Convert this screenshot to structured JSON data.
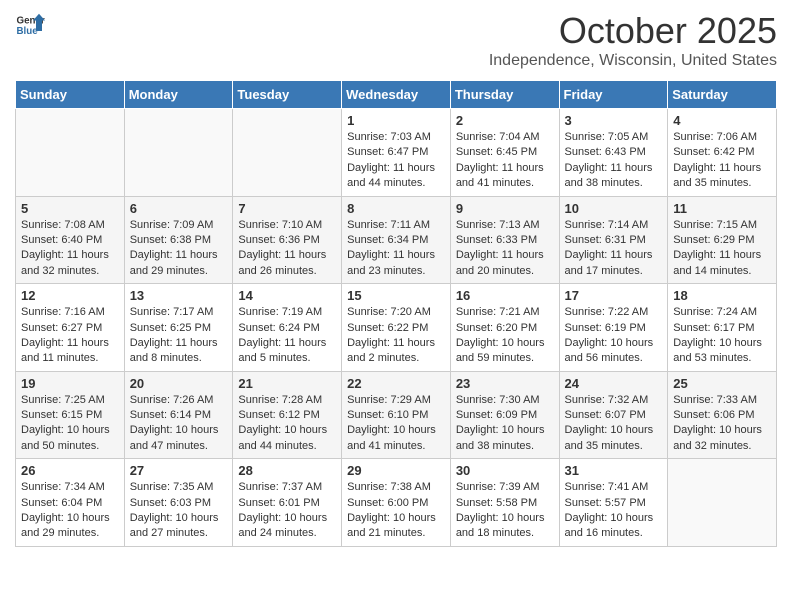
{
  "header": {
    "logo_general": "General",
    "logo_blue": "Blue",
    "title": "October 2025",
    "location": "Independence, Wisconsin, United States"
  },
  "calendar": {
    "days_of_week": [
      "Sunday",
      "Monday",
      "Tuesday",
      "Wednesday",
      "Thursday",
      "Friday",
      "Saturday"
    ],
    "weeks": [
      [
        {
          "day": "",
          "info": ""
        },
        {
          "day": "",
          "info": ""
        },
        {
          "day": "",
          "info": ""
        },
        {
          "day": "1",
          "info": "Sunrise: 7:03 AM\nSunset: 6:47 PM\nDaylight: 11 hours and 44 minutes."
        },
        {
          "day": "2",
          "info": "Sunrise: 7:04 AM\nSunset: 6:45 PM\nDaylight: 11 hours and 41 minutes."
        },
        {
          "day": "3",
          "info": "Sunrise: 7:05 AM\nSunset: 6:43 PM\nDaylight: 11 hours and 38 minutes."
        },
        {
          "day": "4",
          "info": "Sunrise: 7:06 AM\nSunset: 6:42 PM\nDaylight: 11 hours and 35 minutes."
        }
      ],
      [
        {
          "day": "5",
          "info": "Sunrise: 7:08 AM\nSunset: 6:40 PM\nDaylight: 11 hours and 32 minutes."
        },
        {
          "day": "6",
          "info": "Sunrise: 7:09 AM\nSunset: 6:38 PM\nDaylight: 11 hours and 29 minutes."
        },
        {
          "day": "7",
          "info": "Sunrise: 7:10 AM\nSunset: 6:36 PM\nDaylight: 11 hours and 26 minutes."
        },
        {
          "day": "8",
          "info": "Sunrise: 7:11 AM\nSunset: 6:34 PM\nDaylight: 11 hours and 23 minutes."
        },
        {
          "day": "9",
          "info": "Sunrise: 7:13 AM\nSunset: 6:33 PM\nDaylight: 11 hours and 20 minutes."
        },
        {
          "day": "10",
          "info": "Sunrise: 7:14 AM\nSunset: 6:31 PM\nDaylight: 11 hours and 17 minutes."
        },
        {
          "day": "11",
          "info": "Sunrise: 7:15 AM\nSunset: 6:29 PM\nDaylight: 11 hours and 14 minutes."
        }
      ],
      [
        {
          "day": "12",
          "info": "Sunrise: 7:16 AM\nSunset: 6:27 PM\nDaylight: 11 hours and 11 minutes."
        },
        {
          "day": "13",
          "info": "Sunrise: 7:17 AM\nSunset: 6:25 PM\nDaylight: 11 hours and 8 minutes."
        },
        {
          "day": "14",
          "info": "Sunrise: 7:19 AM\nSunset: 6:24 PM\nDaylight: 11 hours and 5 minutes."
        },
        {
          "day": "15",
          "info": "Sunrise: 7:20 AM\nSunset: 6:22 PM\nDaylight: 11 hours and 2 minutes."
        },
        {
          "day": "16",
          "info": "Sunrise: 7:21 AM\nSunset: 6:20 PM\nDaylight: 10 hours and 59 minutes."
        },
        {
          "day": "17",
          "info": "Sunrise: 7:22 AM\nSunset: 6:19 PM\nDaylight: 10 hours and 56 minutes."
        },
        {
          "day": "18",
          "info": "Sunrise: 7:24 AM\nSunset: 6:17 PM\nDaylight: 10 hours and 53 minutes."
        }
      ],
      [
        {
          "day": "19",
          "info": "Sunrise: 7:25 AM\nSunset: 6:15 PM\nDaylight: 10 hours and 50 minutes."
        },
        {
          "day": "20",
          "info": "Sunrise: 7:26 AM\nSunset: 6:14 PM\nDaylight: 10 hours and 47 minutes."
        },
        {
          "day": "21",
          "info": "Sunrise: 7:28 AM\nSunset: 6:12 PM\nDaylight: 10 hours and 44 minutes."
        },
        {
          "day": "22",
          "info": "Sunrise: 7:29 AM\nSunset: 6:10 PM\nDaylight: 10 hours and 41 minutes."
        },
        {
          "day": "23",
          "info": "Sunrise: 7:30 AM\nSunset: 6:09 PM\nDaylight: 10 hours and 38 minutes."
        },
        {
          "day": "24",
          "info": "Sunrise: 7:32 AM\nSunset: 6:07 PM\nDaylight: 10 hours and 35 minutes."
        },
        {
          "day": "25",
          "info": "Sunrise: 7:33 AM\nSunset: 6:06 PM\nDaylight: 10 hours and 32 minutes."
        }
      ],
      [
        {
          "day": "26",
          "info": "Sunrise: 7:34 AM\nSunset: 6:04 PM\nDaylight: 10 hours and 29 minutes."
        },
        {
          "day": "27",
          "info": "Sunrise: 7:35 AM\nSunset: 6:03 PM\nDaylight: 10 hours and 27 minutes."
        },
        {
          "day": "28",
          "info": "Sunrise: 7:37 AM\nSunset: 6:01 PM\nDaylight: 10 hours and 24 minutes."
        },
        {
          "day": "29",
          "info": "Sunrise: 7:38 AM\nSunset: 6:00 PM\nDaylight: 10 hours and 21 minutes."
        },
        {
          "day": "30",
          "info": "Sunrise: 7:39 AM\nSunset: 5:58 PM\nDaylight: 10 hours and 18 minutes."
        },
        {
          "day": "31",
          "info": "Sunrise: 7:41 AM\nSunset: 5:57 PM\nDaylight: 10 hours and 16 minutes."
        },
        {
          "day": "",
          "info": ""
        }
      ]
    ]
  }
}
